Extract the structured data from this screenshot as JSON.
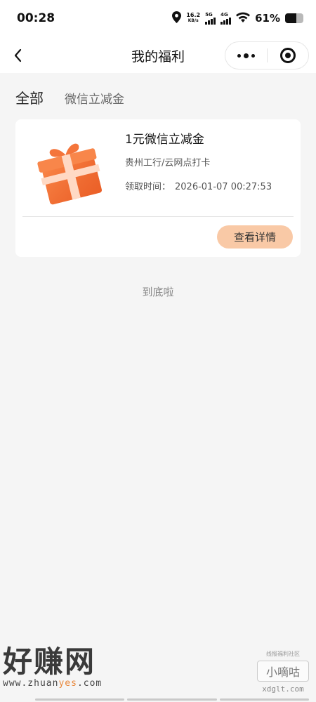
{
  "status_bar": {
    "time": "00:28",
    "net_speed_value": "16.2",
    "net_speed_unit": "KB/s",
    "signal_1_label": "5G",
    "signal_2_label": "4G",
    "battery_percent_text": "61%",
    "battery_level": 0.61,
    "icons": [
      "location-icon",
      "wifi-icon",
      "battery-icon"
    ]
  },
  "nav": {
    "title": "我的福利",
    "back_icon": "chevron-left-icon",
    "menu_icon": "more-dots-icon",
    "close_icon": "target-circle-icon"
  },
  "tabs": [
    {
      "label": "全部",
      "active": true
    },
    {
      "label": "微信立减金",
      "active": false
    }
  ],
  "card": {
    "title": "1元微信立减金",
    "source": "贵州工行/云网点打卡",
    "time_label": "领取时间：",
    "time_value": "2026-01-07 00:27:53",
    "button_label": "查看详情",
    "image_icon": "gift-box-icon"
  },
  "end_text": "到底啦",
  "watermark_left": {
    "title": "好赚网",
    "url_prefix": "www.zhuan",
    "url_highlight": "yes",
    "url_suffix": ".com"
  },
  "watermark_right": {
    "tagline": "线报福利社区",
    "name": "小嘀咕",
    "site": "xdglt.com"
  },
  "colors": {
    "accent_button": "#f9c9a6",
    "gift_orange": "#f26a2e",
    "background": "#f5f5f5"
  }
}
